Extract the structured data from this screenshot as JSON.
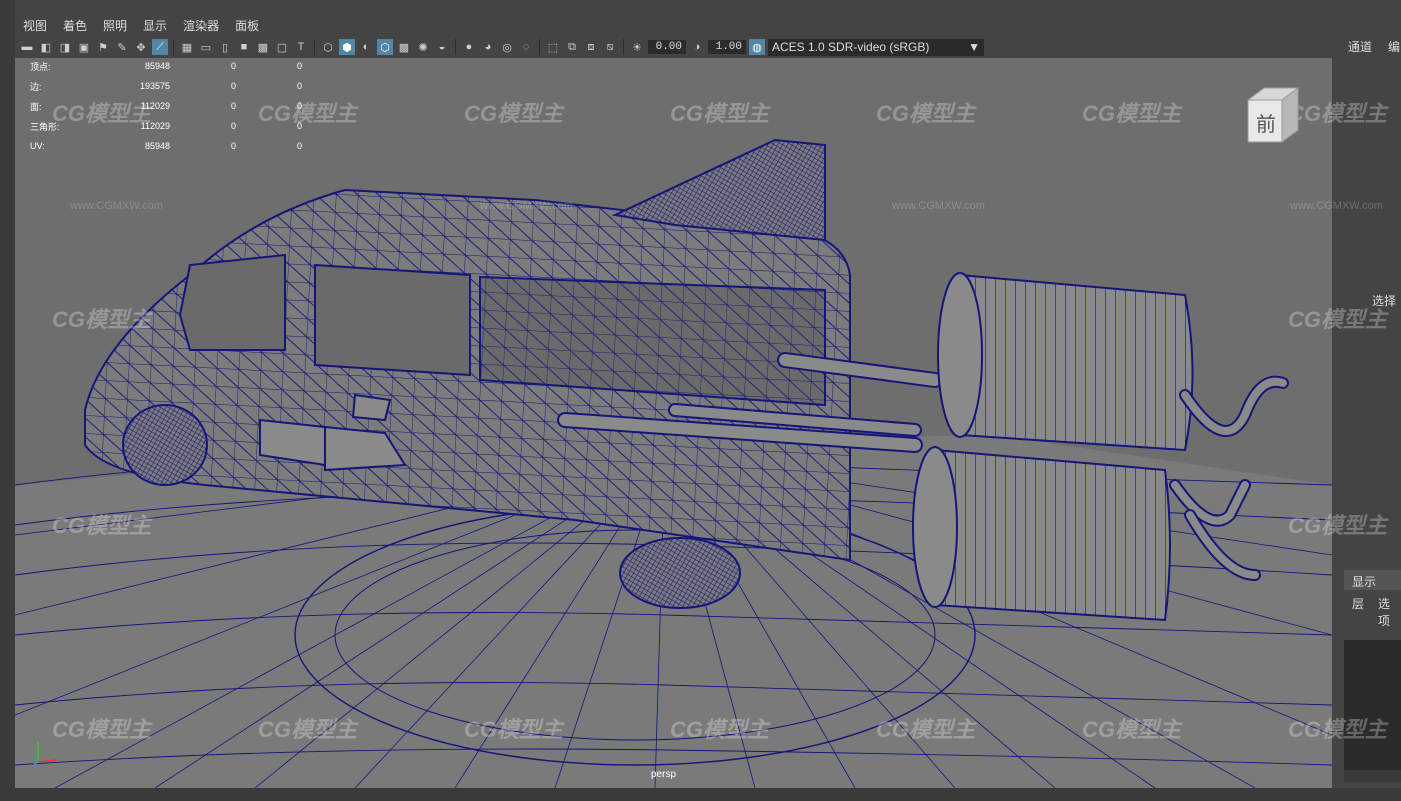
{
  "menubar": {
    "items": [
      "视图",
      "着色",
      "照明",
      "显示",
      "渲染器",
      "面板"
    ]
  },
  "toolbar": {
    "exposure": "0.00",
    "gamma": "1.00",
    "color_space": "ACES 1.0 SDR-video (sRGB)"
  },
  "hud": {
    "rows": [
      {
        "label": "顶点:",
        "v1": "85948",
        "v2": "0",
        "v3": "0"
      },
      {
        "label": "边:",
        "v1": "193575",
        "v2": "0",
        "v3": "0"
      },
      {
        "label": "面:",
        "v1": "112029",
        "v2": "0",
        "v3": "0"
      },
      {
        "label": "三角形:",
        "v1": "112029",
        "v2": "0",
        "v3": "0"
      },
      {
        "label": "UV:",
        "v1": "85948",
        "v2": "0",
        "v3": "0"
      }
    ]
  },
  "viewport": {
    "camera": "persp",
    "viewcube_face": "前"
  },
  "right_panel": {
    "tab_channels": "通道",
    "tab_edit": "编",
    "select_text": "选择",
    "display_tab": "显示",
    "layer_label": "层",
    "options_label": "选项"
  },
  "watermark": {
    "text": "CG模型主",
    "url": "www.CGMXW.com"
  },
  "colors": {
    "wireframe": "#15157a",
    "viewport_bg": "#6e6e6e",
    "accent": "#5285a6"
  }
}
